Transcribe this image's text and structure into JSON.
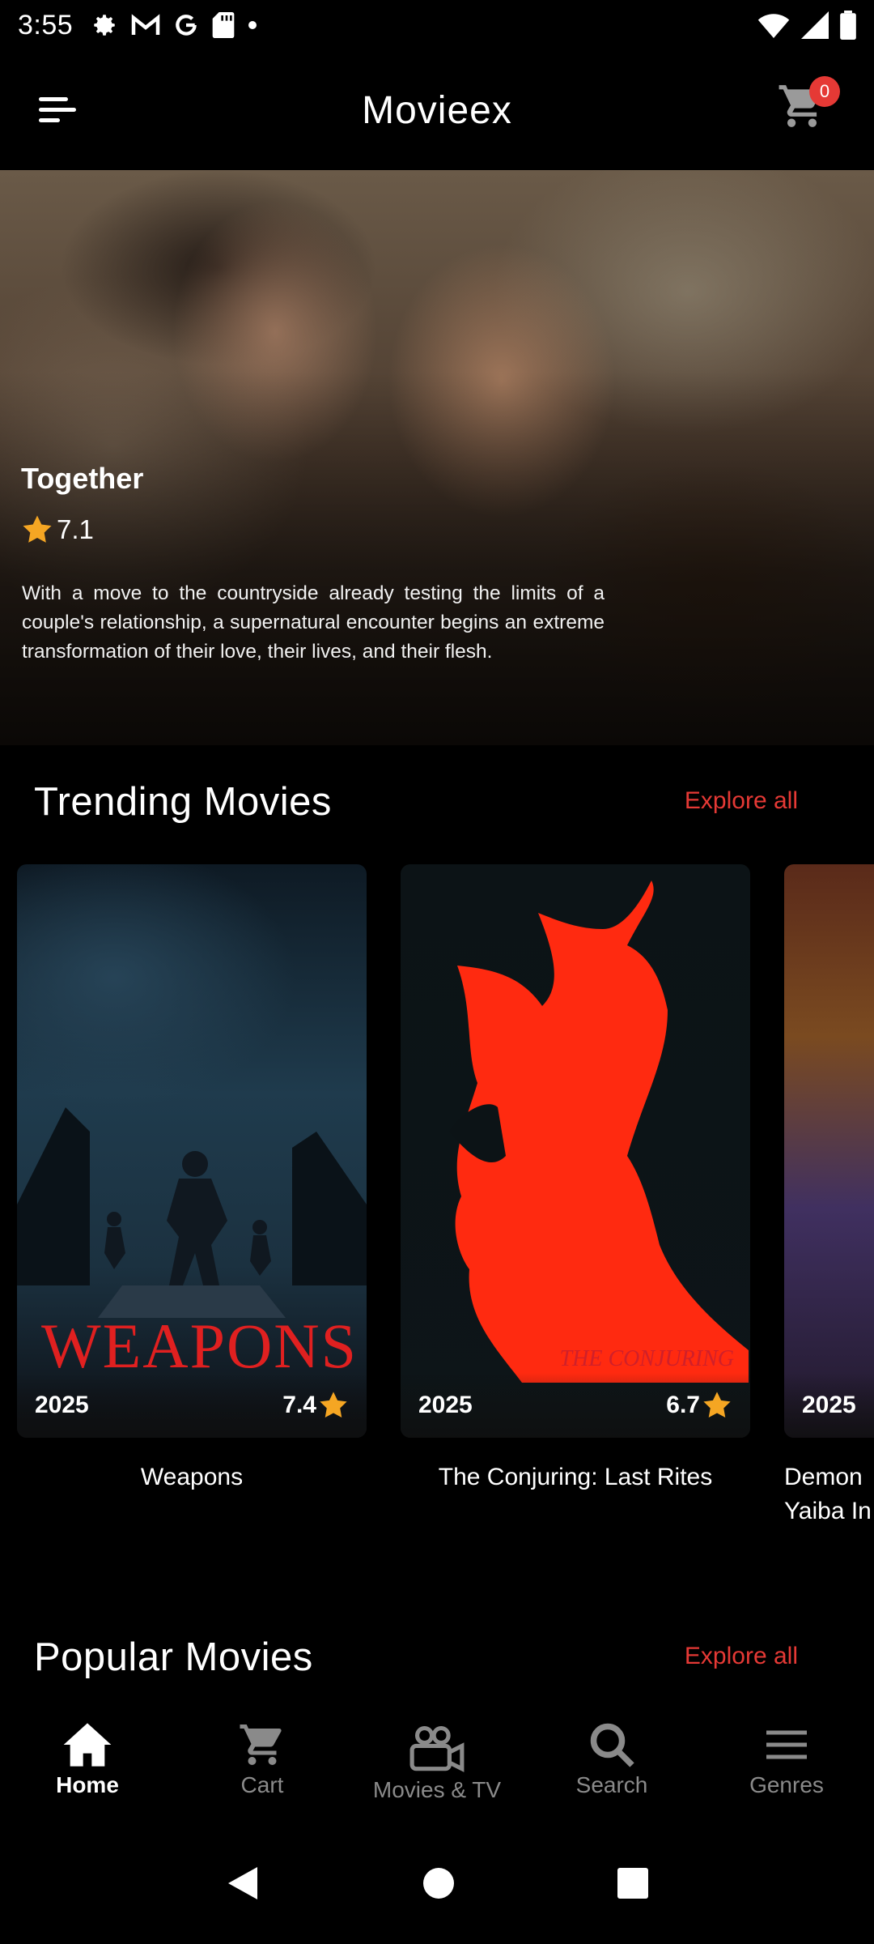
{
  "status_bar": {
    "time": "3:55"
  },
  "app_bar": {
    "title": "Movieex",
    "cart_count": "0"
  },
  "hero": {
    "title": "Together",
    "rating": "7.1",
    "description": "With a move to the countryside already testing the limits of a couple's relationship, a supernatural encounter begins an extreme transformation of their love, their lives, and their flesh."
  },
  "trending": {
    "title": "Trending Movies",
    "explore_label": "Explore all",
    "movies": [
      {
        "title": "Weapons",
        "year": "2025",
        "rating": "7.4",
        "poster_text": "WEAPONS"
      },
      {
        "title": "The Conjuring: Last Rites",
        "year": "2025",
        "rating": "6.7",
        "poster_text": "THE CONJURING"
      },
      {
        "title": "Demon Slayer: Kimetsu no Yaiba Infinity Castle",
        "title_visible_1": "Demon",
        "title_visible_2": "Yaiba In",
        "year": "2025"
      }
    ]
  },
  "popular": {
    "title": "Popular Movies",
    "explore_label": "Explore all"
  },
  "bottom_nav": {
    "items": [
      {
        "label": "Home",
        "icon": "home-icon"
      },
      {
        "label": "Cart",
        "icon": "cart-icon"
      },
      {
        "label": "Movies & TV",
        "icon": "video-camera-icon"
      },
      {
        "label": "Search",
        "icon": "search-icon"
      },
      {
        "label": "Genres",
        "icon": "menu-lines-icon"
      }
    ]
  },
  "colors": {
    "accent": "#e53935",
    "star": "#f5a623",
    "inactive_nav": "#8a8a8a"
  }
}
